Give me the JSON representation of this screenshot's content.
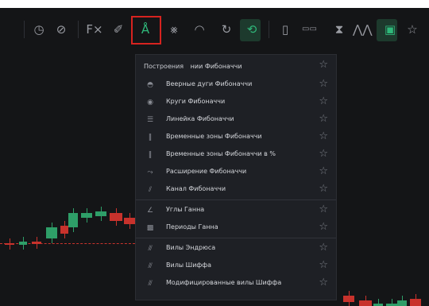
{
  "toolbar": {
    "items": [
      {
        "name": "clock-icon",
        "glyph": "◷"
      },
      {
        "name": "crosshair-icon",
        "glyph": "⊘"
      },
      {
        "name": "fx-icon",
        "glyph": "F×"
      },
      {
        "name": "pencil-icon",
        "glyph": "✐"
      },
      {
        "name": "fibonacci-tool-icon",
        "glyph": "Å"
      },
      {
        "name": "gann-icon",
        "glyph": "⨳"
      },
      {
        "name": "pattern-icon",
        "glyph": "⨰"
      },
      {
        "name": "arc-icon",
        "glyph": "◠"
      },
      {
        "name": "redo-icon",
        "glyph": "↻"
      },
      {
        "name": "replay-icon",
        "glyph": "⟲"
      },
      {
        "name": "measure-icon",
        "glyph": "▯"
      },
      {
        "name": "compare-icon",
        "glyph": "▭▭"
      },
      {
        "name": "hourglass-icon",
        "glyph": "⧗"
      },
      {
        "name": "indicator-icon",
        "glyph": "⋀⋀"
      },
      {
        "name": "calendar-icon",
        "glyph": "▣"
      },
      {
        "name": "favorite-icon",
        "glyph": "☆"
      }
    ]
  },
  "menu": {
    "header": "Построения",
    "header_tail": "нии Фибоначчи",
    "star_glyph": "☆",
    "items": [
      {
        "icon": "fib-fan-arcs-icon",
        "glyph": "◓",
        "label": "Веерные дуги Фибоначчи"
      },
      {
        "icon": "fib-circles-icon",
        "glyph": "◉",
        "label": "Круги Фибоначчи"
      },
      {
        "icon": "fib-ruler-icon",
        "glyph": "☰",
        "label": "Линейка Фибоначчи"
      },
      {
        "icon": "fib-time-zones-icon",
        "glyph": "‖",
        "label": "Временные зоны Фибоначчи"
      },
      {
        "icon": "fib-time-zones-percent-icon",
        "glyph": "‖",
        "label": "Временные зоны Фибоначчи в %"
      },
      {
        "icon": "fib-extension-icon",
        "glyph": "⤳",
        "label": "Расширение Фибоначчи"
      },
      {
        "icon": "fib-channel-icon",
        "glyph": "⫽",
        "label": "Канал Фибоначчи"
      },
      {
        "icon": "gann-angles-icon",
        "glyph": "∠",
        "label": "Углы Ганна"
      },
      {
        "icon": "gann-periods-icon",
        "glyph": "▩",
        "label": "Периоды Ганна"
      },
      {
        "icon": "andrews-pitchfork-icon",
        "glyph": "⫻",
        "label": "Вилы Эндрюса"
      },
      {
        "icon": "schiff-pitchfork-icon",
        "glyph": "⫻",
        "label": "Вилы Шиффа"
      },
      {
        "icon": "modified-schiff-icon",
        "glyph": "⫻",
        "label": "Модифицированные вилы Шиффа"
      }
    ]
  },
  "colors": {
    "bg": "#141517",
    "menu": "#1e2025",
    "up": "#2e9e68",
    "down": "#c8322c",
    "highlight": "#d7231f"
  }
}
